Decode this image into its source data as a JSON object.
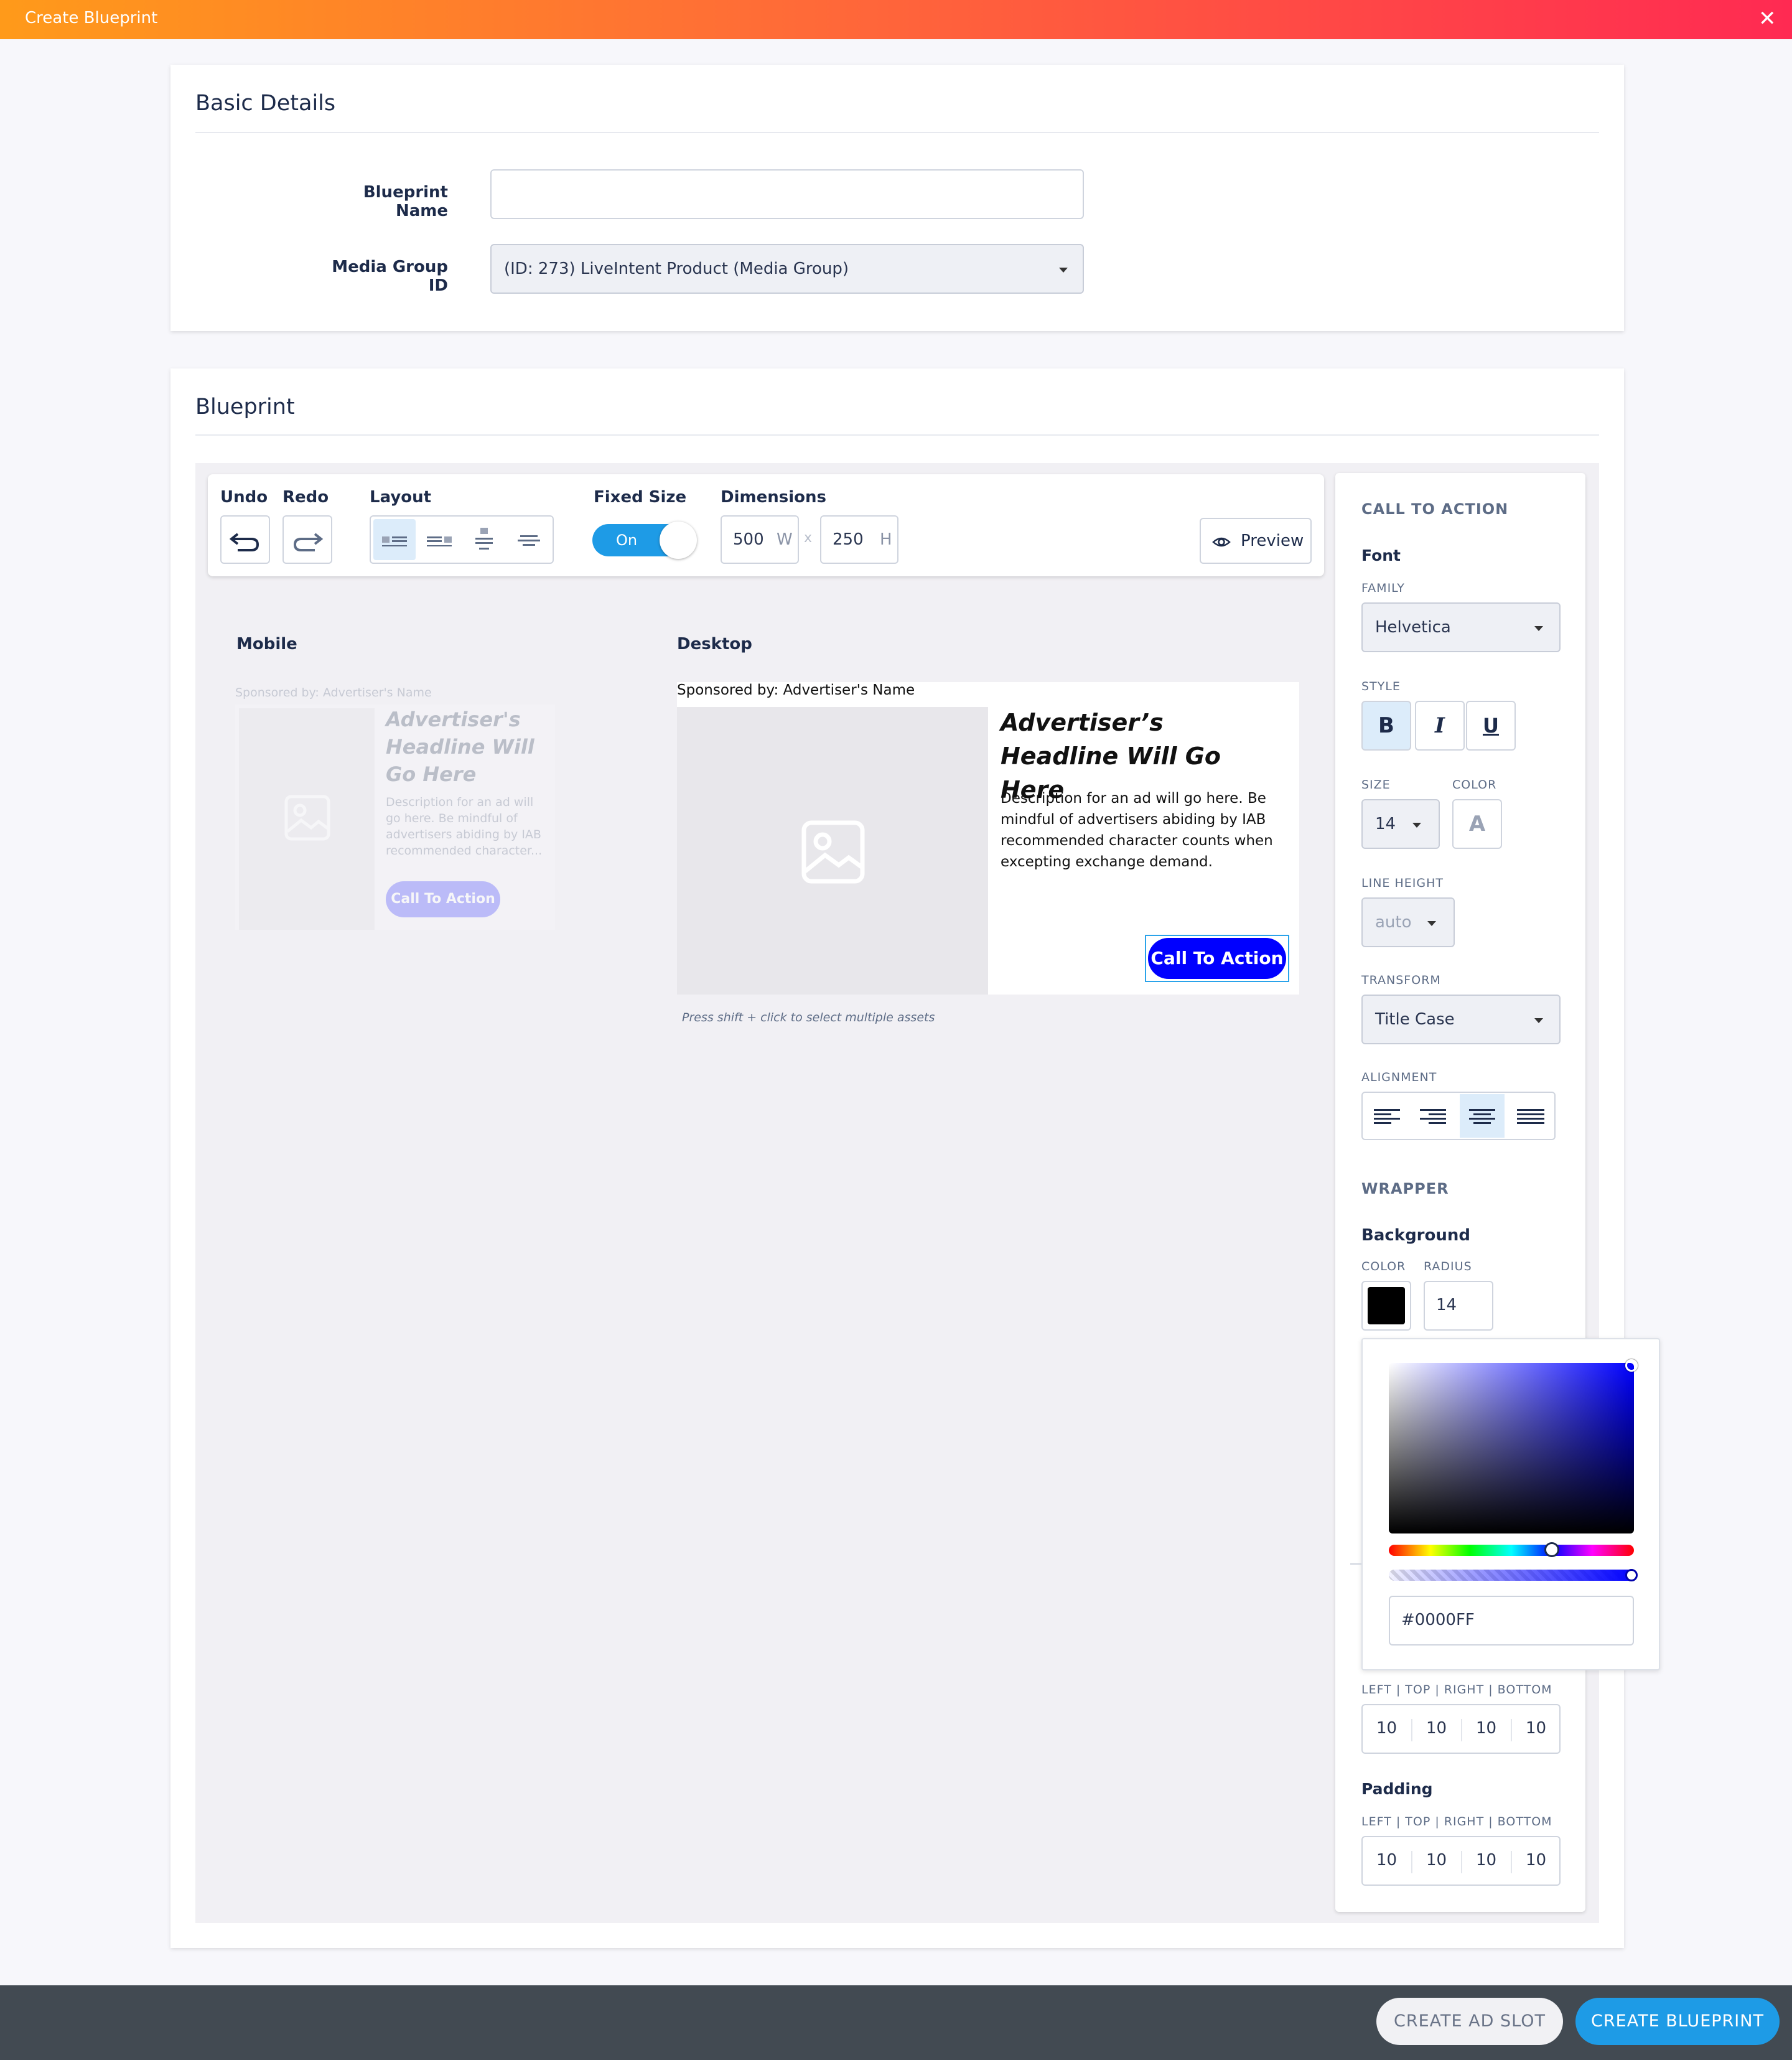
{
  "window": {
    "title": "Create Blueprint",
    "close_icon": "close-icon"
  },
  "basic_details": {
    "title": "Basic Details",
    "blueprint_name_label": "Blueprint Name",
    "blueprint_name_value": "",
    "media_group_label": "Media Group ID",
    "media_group_value": "(ID: 273) LiveIntent Product (Media Group)"
  },
  "blueprint": {
    "title": "Blueprint",
    "toolbar": {
      "undo": "Undo",
      "redo": "Redo",
      "layout": "Layout",
      "fixed_size": "Fixed Size",
      "toggle": "On",
      "dimensions": "Dimensions",
      "width": "500",
      "width_unit": "W",
      "sep": "x",
      "height": "250",
      "height_unit": "H",
      "preview": "Preview"
    },
    "mobile": {
      "label": "Mobile",
      "sponsored": "Sponsored by: Advertiser's Name",
      "headline": "Advertiser's Headline Will Go Here",
      "description": "Description for an ad will go here. Be mindful of advertisers abiding by IAB recommended character...",
      "cta": "Call To Action"
    },
    "desktop": {
      "label": "Desktop",
      "sponsored": "Sponsored by: Advertiser's Name",
      "headline": "Advertiser’s Headline Will Go Here",
      "description": "Description for an ad will go here. Be mindful of advertisers abiding by IAB recommended character counts when excepting exchange demand.",
      "cta": "Call To Action",
      "cta_color": "#0000FF"
    },
    "hint": "Press shift + click to select multiple assets"
  },
  "panel": {
    "section": "CALL TO ACTION",
    "font": "Font",
    "family_label": "FAMILY",
    "family_value": "Helvetica",
    "style_label": "STYLE",
    "bold": "B",
    "italic": "I",
    "underline": "U",
    "size_label": "SIZE",
    "size_value": "14",
    "color_label": "COLOR",
    "color_glyph": "A",
    "line_height_label": "LINE HEIGHT",
    "line_height_value": "auto",
    "transform_label": "TRANSFORM",
    "transform_value": "Title Case",
    "alignment_label": "ALIGNMENT",
    "wrapper": "WRAPPER",
    "background": "Background",
    "bg_color_label": "COLOR",
    "bg_radius_label": "RADIUS",
    "bg_radius_value": "14",
    "bg_color": "#000000",
    "picker": {
      "hex": "#0000FF",
      "hue_pct": 66,
      "alpha_pct": 100
    },
    "margin_lrtb_label": "LEFT | TOP | RIGHT | BOTTOM",
    "margin": [
      "10",
      "10",
      "10",
      "10"
    ],
    "padding": "Padding",
    "padding_lrtb_label": "LEFT | TOP | RIGHT | BOTTOM",
    "padding_values": [
      "10",
      "10",
      "10",
      "10"
    ]
  },
  "footer": {
    "create_ad_slot": "CREATE AD SLOT",
    "create_blueprint": "CREATE BLUEPRINT"
  }
}
